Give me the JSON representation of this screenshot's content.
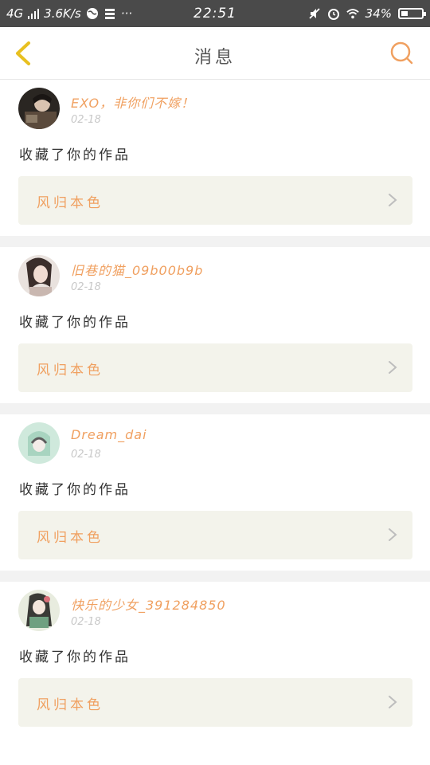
{
  "status_bar": {
    "network": "4G",
    "speed": "3.6K/s",
    "time": "22:51",
    "battery": "34%",
    "battery_level": 0.34,
    "icons": [
      "signal-icon",
      "globe-icon",
      "data-icon",
      "more-icon",
      "mute-icon",
      "alarm-icon",
      "wifi-icon",
      "battery-icon"
    ],
    "more": "···"
  },
  "header": {
    "title": "消息",
    "back_icon": "chevron-left-icon",
    "search_icon": "search-icon"
  },
  "colors": {
    "accent": "#f0a060",
    "back_arrow": "#e8c020",
    "card_bg": "#f3f3eb",
    "separator": "#f2f2f2"
  },
  "messages": [
    {
      "username": "EXO，非你们不嫁！",
      "date": "02-18",
      "action": "收藏了你的作品",
      "work_title": "风归本色"
    },
    {
      "username": "旧巷的猫_09b00b9b",
      "date": "02-18",
      "action": "收藏了你的作品",
      "work_title": "风归本色"
    },
    {
      "username": "Dream_dai",
      "date": "02-18",
      "action": "收藏了你的作品",
      "work_title": "风归本色"
    },
    {
      "username": "快乐的少女_391284850",
      "date": "02-18",
      "action": "收藏了你的作品",
      "work_title": "风归本色"
    }
  ]
}
